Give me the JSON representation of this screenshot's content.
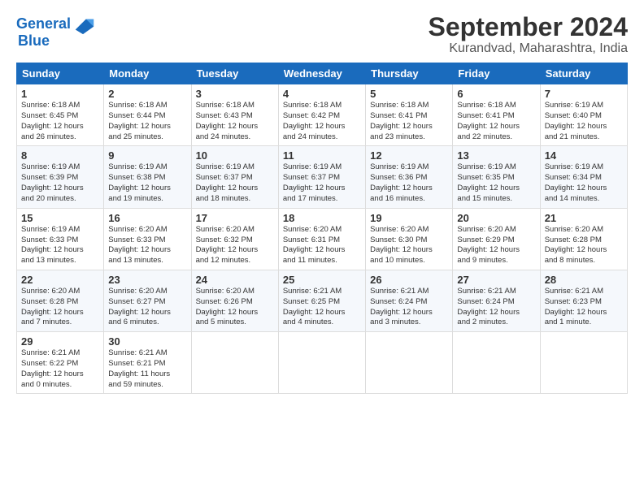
{
  "header": {
    "logo_line1": "General",
    "logo_line2": "Blue",
    "title": "September 2024",
    "subtitle": "Kurandvad, Maharashtra, India"
  },
  "days_of_week": [
    "Sunday",
    "Monday",
    "Tuesday",
    "Wednesday",
    "Thursday",
    "Friday",
    "Saturday"
  ],
  "weeks": [
    [
      {
        "day": "1",
        "detail": "Sunrise: 6:18 AM\nSunset: 6:45 PM\nDaylight: 12 hours\nand 26 minutes."
      },
      {
        "day": "2",
        "detail": "Sunrise: 6:18 AM\nSunset: 6:44 PM\nDaylight: 12 hours\nand 25 minutes."
      },
      {
        "day": "3",
        "detail": "Sunrise: 6:18 AM\nSunset: 6:43 PM\nDaylight: 12 hours\nand 24 minutes."
      },
      {
        "day": "4",
        "detail": "Sunrise: 6:18 AM\nSunset: 6:42 PM\nDaylight: 12 hours\nand 24 minutes."
      },
      {
        "day": "5",
        "detail": "Sunrise: 6:18 AM\nSunset: 6:41 PM\nDaylight: 12 hours\nand 23 minutes."
      },
      {
        "day": "6",
        "detail": "Sunrise: 6:18 AM\nSunset: 6:41 PM\nDaylight: 12 hours\nand 22 minutes."
      },
      {
        "day": "7",
        "detail": "Sunrise: 6:19 AM\nSunset: 6:40 PM\nDaylight: 12 hours\nand 21 minutes."
      }
    ],
    [
      {
        "day": "8",
        "detail": "Sunrise: 6:19 AM\nSunset: 6:39 PM\nDaylight: 12 hours\nand 20 minutes."
      },
      {
        "day": "9",
        "detail": "Sunrise: 6:19 AM\nSunset: 6:38 PM\nDaylight: 12 hours\nand 19 minutes."
      },
      {
        "day": "10",
        "detail": "Sunrise: 6:19 AM\nSunset: 6:37 PM\nDaylight: 12 hours\nand 18 minutes."
      },
      {
        "day": "11",
        "detail": "Sunrise: 6:19 AM\nSunset: 6:37 PM\nDaylight: 12 hours\nand 17 minutes."
      },
      {
        "day": "12",
        "detail": "Sunrise: 6:19 AM\nSunset: 6:36 PM\nDaylight: 12 hours\nand 16 minutes."
      },
      {
        "day": "13",
        "detail": "Sunrise: 6:19 AM\nSunset: 6:35 PM\nDaylight: 12 hours\nand 15 minutes."
      },
      {
        "day": "14",
        "detail": "Sunrise: 6:19 AM\nSunset: 6:34 PM\nDaylight: 12 hours\nand 14 minutes."
      }
    ],
    [
      {
        "day": "15",
        "detail": "Sunrise: 6:19 AM\nSunset: 6:33 PM\nDaylight: 12 hours\nand 13 minutes."
      },
      {
        "day": "16",
        "detail": "Sunrise: 6:20 AM\nSunset: 6:33 PM\nDaylight: 12 hours\nand 13 minutes."
      },
      {
        "day": "17",
        "detail": "Sunrise: 6:20 AM\nSunset: 6:32 PM\nDaylight: 12 hours\nand 12 minutes."
      },
      {
        "day": "18",
        "detail": "Sunrise: 6:20 AM\nSunset: 6:31 PM\nDaylight: 12 hours\nand 11 minutes."
      },
      {
        "day": "19",
        "detail": "Sunrise: 6:20 AM\nSunset: 6:30 PM\nDaylight: 12 hours\nand 10 minutes."
      },
      {
        "day": "20",
        "detail": "Sunrise: 6:20 AM\nSunset: 6:29 PM\nDaylight: 12 hours\nand 9 minutes."
      },
      {
        "day": "21",
        "detail": "Sunrise: 6:20 AM\nSunset: 6:28 PM\nDaylight: 12 hours\nand 8 minutes."
      }
    ],
    [
      {
        "day": "22",
        "detail": "Sunrise: 6:20 AM\nSunset: 6:28 PM\nDaylight: 12 hours\nand 7 minutes."
      },
      {
        "day": "23",
        "detail": "Sunrise: 6:20 AM\nSunset: 6:27 PM\nDaylight: 12 hours\nand 6 minutes."
      },
      {
        "day": "24",
        "detail": "Sunrise: 6:20 AM\nSunset: 6:26 PM\nDaylight: 12 hours\nand 5 minutes."
      },
      {
        "day": "25",
        "detail": "Sunrise: 6:21 AM\nSunset: 6:25 PM\nDaylight: 12 hours\nand 4 minutes."
      },
      {
        "day": "26",
        "detail": "Sunrise: 6:21 AM\nSunset: 6:24 PM\nDaylight: 12 hours\nand 3 minutes."
      },
      {
        "day": "27",
        "detail": "Sunrise: 6:21 AM\nSunset: 6:24 PM\nDaylight: 12 hours\nand 2 minutes."
      },
      {
        "day": "28",
        "detail": "Sunrise: 6:21 AM\nSunset: 6:23 PM\nDaylight: 12 hours\nand 1 minute."
      }
    ],
    [
      {
        "day": "29",
        "detail": "Sunrise: 6:21 AM\nSunset: 6:22 PM\nDaylight: 12 hours\nand 0 minutes."
      },
      {
        "day": "30",
        "detail": "Sunrise: 6:21 AM\nSunset: 6:21 PM\nDaylight: 11 hours\nand 59 minutes."
      },
      {
        "day": "",
        "detail": ""
      },
      {
        "day": "",
        "detail": ""
      },
      {
        "day": "",
        "detail": ""
      },
      {
        "day": "",
        "detail": ""
      },
      {
        "day": "",
        "detail": ""
      }
    ]
  ]
}
